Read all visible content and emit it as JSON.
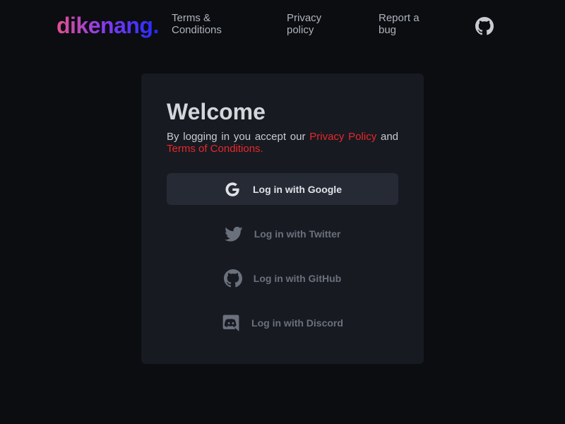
{
  "header": {
    "logo": "dikenang.",
    "nav": [
      {
        "label": "Terms & Conditions"
      },
      {
        "label": "Privacy policy"
      },
      {
        "label": "Report a bug"
      }
    ],
    "github_icon": "github-icon"
  },
  "card": {
    "title": "Welcome",
    "terms": {
      "prefix": "By logging in you accept our ",
      "privacy_link": "Privacy Policy",
      "middle": " and ",
      "terms_link": "Terms of Conditions."
    },
    "buttons": [
      {
        "label": "Log in with Google",
        "icon": "google-icon"
      },
      {
        "label": "Log in with Twitter",
        "icon": "twitter-icon"
      },
      {
        "label": "Log in with GitHub",
        "icon": "github-icon"
      },
      {
        "label": "Log in with Discord",
        "icon": "discord-icon"
      }
    ]
  },
  "colors": {
    "background": "#0b0d10",
    "card": "#171a21",
    "accent_red": "#e8282c",
    "logo_gradient": [
      "#e4508f",
      "#8a3cf0",
      "#1f2bff"
    ]
  }
}
